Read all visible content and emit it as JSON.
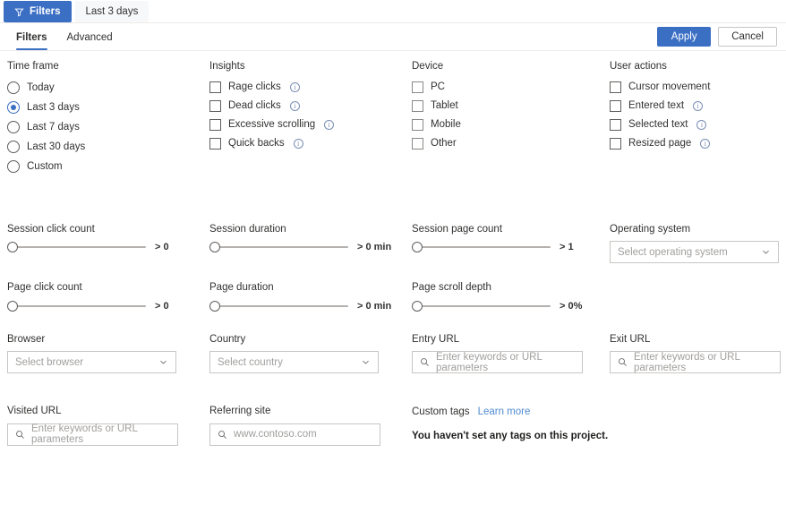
{
  "topbar": {
    "filters_button": "Filters",
    "filter_chip": "Last 3 days",
    "funnel_icon": "funnel-icon"
  },
  "tabstrip": {
    "tabs": [
      {
        "label": "Filters",
        "active": true
      },
      {
        "label": "Advanced",
        "active": false
      }
    ],
    "apply_label": "Apply",
    "cancel_label": "Cancel",
    "accent_color": "#3b6fc4"
  },
  "time_frame": {
    "title": "Time frame",
    "options": [
      {
        "label": "Today",
        "checked": false
      },
      {
        "label": "Last 3 days",
        "checked": true
      },
      {
        "label": "Last 7 days",
        "checked": false
      },
      {
        "label": "Last 30 days",
        "checked": false
      },
      {
        "label": "Custom",
        "checked": false
      }
    ]
  },
  "insights": {
    "title": "Insights",
    "options": [
      {
        "label": "Rage clicks",
        "checked": false,
        "info": true
      },
      {
        "label": "Dead clicks",
        "checked": false,
        "info": true
      },
      {
        "label": "Excessive scrolling",
        "checked": false,
        "info": true
      },
      {
        "label": "Quick backs",
        "checked": false,
        "info": true
      }
    ]
  },
  "device": {
    "title": "Device",
    "options": [
      {
        "label": "PC",
        "checked": false,
        "info": false
      },
      {
        "label": "Tablet",
        "checked": false,
        "info": false
      },
      {
        "label": "Mobile",
        "checked": false,
        "info": false
      },
      {
        "label": "Other",
        "checked": false,
        "info": false
      }
    ]
  },
  "user_actions": {
    "title": "User actions",
    "options": [
      {
        "label": "Cursor movement",
        "checked": false,
        "info": false
      },
      {
        "label": "Entered text",
        "checked": false,
        "info": true
      },
      {
        "label": "Selected text",
        "checked": false,
        "info": true
      },
      {
        "label": "Resized page",
        "checked": false,
        "info": true
      }
    ]
  },
  "sliders": {
    "session_click_count": {
      "label": "Session click count",
      "value": "> 0"
    },
    "session_duration": {
      "label": "Session duration",
      "value": "> 0 min"
    },
    "session_page_count": {
      "label": "Session page count",
      "value": "> 1"
    },
    "page_click_count": {
      "label": "Page click count",
      "value": "> 0"
    },
    "page_duration": {
      "label": "Page duration",
      "value": "> 0 min"
    },
    "page_scroll_depth": {
      "label": "Page scroll depth",
      "value": "> 0%"
    }
  },
  "operating_system": {
    "label": "Operating system",
    "placeholder": "Select operating system"
  },
  "browser": {
    "label": "Browser",
    "placeholder": "Select browser"
  },
  "country": {
    "label": "Country",
    "placeholder": "Select country"
  },
  "entry_url": {
    "label": "Entry URL",
    "placeholder": "Enter keywords or URL parameters"
  },
  "exit_url": {
    "label": "Exit URL",
    "placeholder": "Enter keywords or URL parameters"
  },
  "visited_url": {
    "label": "Visited URL",
    "placeholder": "Enter keywords or URL parameters"
  },
  "referring_site": {
    "label": "Referring site",
    "placeholder": "www.contoso.com"
  },
  "custom_tags": {
    "label": "Custom tags",
    "learn_more": "Learn more",
    "empty_message": "You haven't set any tags on this project."
  }
}
